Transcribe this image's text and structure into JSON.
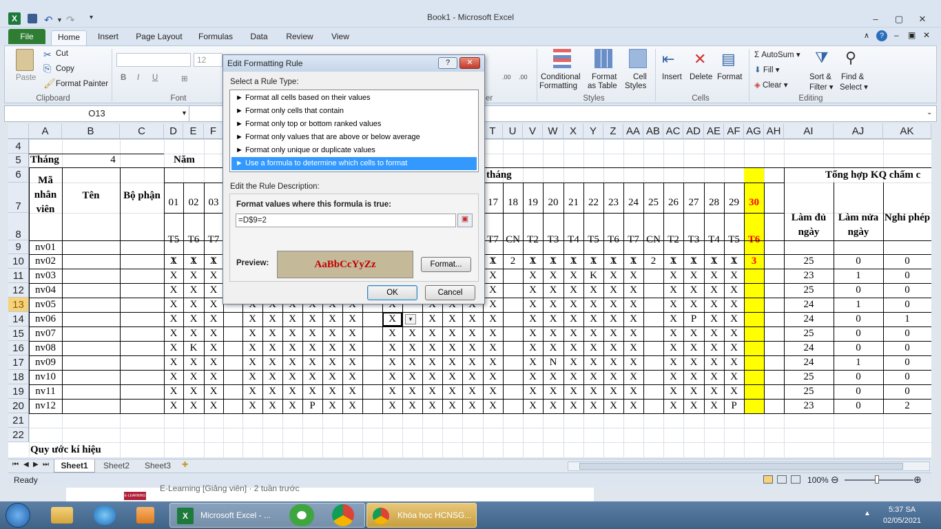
{
  "window": {
    "title": "Book1  -  Microsoft Excel"
  },
  "ribbon": {
    "tabs": [
      "File",
      "Home",
      "Insert",
      "Page Layout",
      "Formulas",
      "Data",
      "Review",
      "View"
    ],
    "clipboard": {
      "paste": "Paste",
      "cut": "Cut",
      "copy": "Copy",
      "format_painter": "Format Painter",
      "label": "Clipboard"
    },
    "font": {
      "size": "12",
      "label": "Font"
    },
    "styles": {
      "conditional": "Conditional",
      "conditional2": "Formatting",
      "format_table": "Format",
      "format_table2": "as Table",
      "cell_styles": "Cell",
      "cell_styles2": "Styles",
      "label": "Styles"
    },
    "cells": {
      "insert": "Insert",
      "delete": "Delete",
      "format": "Format",
      "label": "Cells"
    },
    "editing": {
      "autosum": "AutoSum",
      "fill": "Fill",
      "clear": "Clear",
      "sort": "Sort &",
      "sort2": "Filter",
      "find": "Find &",
      "find2": "Select",
      "label": "Editing"
    },
    "number_tail": "er"
  },
  "formula_bar": {
    "name_box": "O13"
  },
  "sheet": {
    "col_headers": [
      "A",
      "B",
      "C",
      "D",
      "E",
      "F",
      "T",
      "U",
      "V",
      "W",
      "X",
      "Y",
      "Z",
      "AA",
      "AB",
      "AC",
      "AD",
      "AE",
      "AF",
      "AG",
      "AH",
      "AI",
      "AJ",
      "AK"
    ],
    "row_headers": [
      "4",
      "5",
      "6",
      "7",
      "8",
      "9",
      "10",
      "11",
      "12",
      "13",
      "14",
      "15",
      "16",
      "17",
      "18",
      "19",
      "20",
      "21",
      "22"
    ],
    "thang_label": "Tháng",
    "thang_value": "4",
    "nam_label": "Năm",
    "ma_nv": "Mã nhân viên",
    "ten": "Tên",
    "bo_phan": "Bộ phận",
    "thang_header": "tháng",
    "tong_hop": "Tổng hợp KQ chấm c",
    "lam_du": "Làm đủ ngày",
    "lam_nua": "Làm nửa ngày",
    "nghi_phep": "Nghỉ phép",
    "days_left": [
      "01",
      "02",
      "03"
    ],
    "dow_left": [
      "T5",
      "T6",
      "T7"
    ],
    "days_right": [
      "17",
      "18",
      "19",
      "20",
      "21",
      "22",
      "23",
      "24",
      "25",
      "26",
      "27",
      "28",
      "29",
      "30"
    ],
    "dow_right": [
      "T7",
      "CN",
      "T2",
      "T3",
      "T4",
      "T5",
      "T6",
      "T7",
      "CN",
      "T2",
      "T3",
      "T4",
      "T5",
      "T6"
    ],
    "row9_left": [
      "1",
      "1",
      "1"
    ],
    "row9_right": [
      "1",
      "2",
      "1",
      "1",
      "1",
      "1",
      "1",
      "1",
      "2",
      "1",
      "1",
      "1",
      "1",
      "3"
    ],
    "employees": [
      {
        "id": "nv01"
      },
      {
        "id": "nv02",
        "L": [
          "X",
          "X",
          "X"
        ],
        "M": [],
        "R": [
          "X",
          "",
          "X",
          "X",
          "X",
          "X",
          "X",
          "X",
          "",
          "X",
          "X",
          "X",
          "X"
        ],
        "tot": [
          "25",
          "0",
          "0"
        ]
      },
      {
        "id": "nv03",
        "L": [
          "X",
          "X",
          "X"
        ],
        "M": [],
        "R": [
          "X",
          "",
          "X",
          "X",
          "X",
          "K",
          "X",
          "X",
          "",
          "X",
          "X",
          "X",
          "X"
        ],
        "tot": [
          "23",
          "1",
          "0"
        ]
      },
      {
        "id": "nv04",
        "L": [
          "X",
          "X",
          "X"
        ],
        "M": [],
        "R": [
          "X",
          "",
          "X",
          "X",
          "X",
          "X",
          "X",
          "X",
          "",
          "X",
          "X",
          "X",
          "X"
        ],
        "tot": [
          "25",
          "0",
          "0"
        ]
      },
      {
        "id": "nv05",
        "L": [
          "X",
          "X",
          "X"
        ],
        "M": [
          "X",
          "X",
          "X",
          "X",
          "X",
          "X",
          "",
          "X",
          "",
          "X",
          "X",
          "X"
        ],
        "R": [
          "X",
          "",
          "X",
          "X",
          "X",
          "X",
          "X",
          "X",
          "",
          "X",
          "X",
          "X",
          "X"
        ],
        "tot": [
          "24",
          "1",
          "0"
        ]
      },
      {
        "id": "nv06",
        "L": [
          "X",
          "X",
          "X"
        ],
        "M": [
          "X",
          "X",
          "X",
          "X",
          "X",
          "X",
          "",
          "X",
          "X",
          "X",
          "X",
          "X"
        ],
        "R": [
          "X",
          "",
          "X",
          "X",
          "X",
          "X",
          "X",
          "X",
          "",
          "X",
          "P",
          "X",
          "X"
        ],
        "tot": [
          "24",
          "0",
          "1"
        ]
      },
      {
        "id": "nv07",
        "L": [
          "X",
          "X",
          "X"
        ],
        "M": [
          "X",
          "X",
          "X",
          "X",
          "X",
          "X",
          "",
          "X",
          "X",
          "X",
          "X",
          "X"
        ],
        "R": [
          "X",
          "",
          "X",
          "X",
          "X",
          "X",
          "X",
          "X",
          "",
          "X",
          "X",
          "X",
          "X"
        ],
        "tot": [
          "25",
          "0",
          "0"
        ]
      },
      {
        "id": "nv08",
        "L": [
          "X",
          "K",
          "X"
        ],
        "M": [
          "X",
          "X",
          "X",
          "X",
          "X",
          "X",
          "",
          "X",
          "X",
          "X",
          "X",
          "X"
        ],
        "R": [
          "X",
          "",
          "X",
          "X",
          "X",
          "X",
          "X",
          "X",
          "",
          "X",
          "X",
          "X",
          "X"
        ],
        "tot": [
          "24",
          "0",
          "0"
        ]
      },
      {
        "id": "nv09",
        "L": [
          "X",
          "X",
          "X"
        ],
        "M": [
          "X",
          "X",
          "X",
          "X",
          "X",
          "X",
          "",
          "X",
          "X",
          "X",
          "X",
          "X"
        ],
        "R": [
          "X",
          "",
          "X",
          "N",
          "X",
          "X",
          "X",
          "X",
          "",
          "X",
          "X",
          "X",
          "X"
        ],
        "tot": [
          "24",
          "1",
          "0"
        ]
      },
      {
        "id": "nv10",
        "L": [
          "X",
          "X",
          "X"
        ],
        "M": [
          "X",
          "X",
          "X",
          "X",
          "X",
          "X",
          "",
          "X",
          "X",
          "X",
          "X",
          "X"
        ],
        "R": [
          "X",
          "",
          "X",
          "X",
          "X",
          "X",
          "X",
          "X",
          "",
          "X",
          "X",
          "X",
          "X"
        ],
        "tot": [
          "25",
          "0",
          "0"
        ]
      },
      {
        "id": "nv11",
        "L": [
          "X",
          "X",
          "X"
        ],
        "M": [
          "X",
          "X",
          "X",
          "X",
          "X",
          "X",
          "",
          "X",
          "X",
          "X",
          "X",
          "X"
        ],
        "R": [
          "X",
          "",
          "X",
          "X",
          "X",
          "X",
          "X",
          "X",
          "",
          "X",
          "X",
          "X",
          "X"
        ],
        "tot": [
          "25",
          "0",
          "0"
        ]
      },
      {
        "id": "nv12",
        "L": [
          "X",
          "X",
          "X"
        ],
        "M": [
          "X",
          "X",
          "X",
          "P",
          "X",
          "X",
          "",
          "X",
          "X",
          "X",
          "X",
          "X"
        ],
        "R": [
          "X",
          "",
          "X",
          "X",
          "X",
          "X",
          "X",
          "X",
          "",
          "X",
          "X",
          "X",
          "P"
        ],
        "tot": [
          "23",
          "0",
          "2"
        ]
      }
    ],
    "quy_uoc": "Quy ước kí hiệu"
  },
  "sheet_tabs": [
    "Sheet1",
    "Sheet2",
    "Sheet3"
  ],
  "status": {
    "ready": "Ready",
    "zoom": "100%"
  },
  "dialog": {
    "title": "Edit Formatting Rule",
    "select_label": "Select a Rule Type:",
    "rules": [
      "► Format all cells based on their values",
      "► Format only cells that contain",
      "► Format only top or bottom ranked values",
      "► Format only values that are above or below average",
      "► Format only unique or duplicate values",
      "► Use a formula to determine which cells to format"
    ],
    "edit_label": "Edit the Rule Description:",
    "formula_label": "Format values where this formula is true:",
    "formula_value": "=D$9=2",
    "preview_label": "Preview:",
    "preview_text": "AaBbCcYyZz",
    "format_btn": "Format...",
    "ok": "OK",
    "cancel": "Cancel"
  },
  "background_snippet": {
    "text": "E-Learning [Giảng viên] · 2 tuần trước",
    "badge": "E-LEARNING"
  },
  "taskbar": {
    "excel": "Microsoft Excel - ...",
    "chrome": "Khóa học HCNSG...",
    "time": "5:37 SA",
    "date": "02/05/2021"
  }
}
